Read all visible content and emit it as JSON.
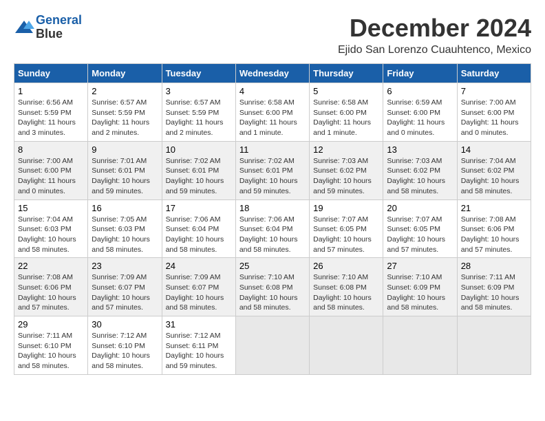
{
  "header": {
    "logo_line1": "General",
    "logo_line2": "Blue",
    "month_title": "December 2024",
    "location": "Ejido San Lorenzo Cuauhtenco, Mexico"
  },
  "days_of_week": [
    "Sunday",
    "Monday",
    "Tuesday",
    "Wednesday",
    "Thursday",
    "Friday",
    "Saturday"
  ],
  "weeks": [
    [
      {
        "day": "1",
        "sunrise": "6:56 AM",
        "sunset": "5:59 PM",
        "daylight": "11 hours and 3 minutes."
      },
      {
        "day": "2",
        "sunrise": "6:57 AM",
        "sunset": "5:59 PM",
        "daylight": "11 hours and 2 minutes."
      },
      {
        "day": "3",
        "sunrise": "6:57 AM",
        "sunset": "5:59 PM",
        "daylight": "11 hours and 2 minutes."
      },
      {
        "day": "4",
        "sunrise": "6:58 AM",
        "sunset": "6:00 PM",
        "daylight": "11 hours and 1 minute."
      },
      {
        "day": "5",
        "sunrise": "6:58 AM",
        "sunset": "6:00 PM",
        "daylight": "11 hours and 1 minute."
      },
      {
        "day": "6",
        "sunrise": "6:59 AM",
        "sunset": "6:00 PM",
        "daylight": "11 hours and 0 minutes."
      },
      {
        "day": "7",
        "sunrise": "7:00 AM",
        "sunset": "6:00 PM",
        "daylight": "11 hours and 0 minutes."
      }
    ],
    [
      {
        "day": "8",
        "sunrise": "7:00 AM",
        "sunset": "6:00 PM",
        "daylight": "11 hours and 0 minutes."
      },
      {
        "day": "9",
        "sunrise": "7:01 AM",
        "sunset": "6:01 PM",
        "daylight": "10 hours and 59 minutes."
      },
      {
        "day": "10",
        "sunrise": "7:02 AM",
        "sunset": "6:01 PM",
        "daylight": "10 hours and 59 minutes."
      },
      {
        "day": "11",
        "sunrise": "7:02 AM",
        "sunset": "6:01 PM",
        "daylight": "10 hours and 59 minutes."
      },
      {
        "day": "12",
        "sunrise": "7:03 AM",
        "sunset": "6:02 PM",
        "daylight": "10 hours and 59 minutes."
      },
      {
        "day": "13",
        "sunrise": "7:03 AM",
        "sunset": "6:02 PM",
        "daylight": "10 hours and 58 minutes."
      },
      {
        "day": "14",
        "sunrise": "7:04 AM",
        "sunset": "6:02 PM",
        "daylight": "10 hours and 58 minutes."
      }
    ],
    [
      {
        "day": "15",
        "sunrise": "7:04 AM",
        "sunset": "6:03 PM",
        "daylight": "10 hours and 58 minutes."
      },
      {
        "day": "16",
        "sunrise": "7:05 AM",
        "sunset": "6:03 PM",
        "daylight": "10 hours and 58 minutes."
      },
      {
        "day": "17",
        "sunrise": "7:06 AM",
        "sunset": "6:04 PM",
        "daylight": "10 hours and 58 minutes."
      },
      {
        "day": "18",
        "sunrise": "7:06 AM",
        "sunset": "6:04 PM",
        "daylight": "10 hours and 58 minutes."
      },
      {
        "day": "19",
        "sunrise": "7:07 AM",
        "sunset": "6:05 PM",
        "daylight": "10 hours and 57 minutes."
      },
      {
        "day": "20",
        "sunrise": "7:07 AM",
        "sunset": "6:05 PM",
        "daylight": "10 hours and 57 minutes."
      },
      {
        "day": "21",
        "sunrise": "7:08 AM",
        "sunset": "6:06 PM",
        "daylight": "10 hours and 57 minutes."
      }
    ],
    [
      {
        "day": "22",
        "sunrise": "7:08 AM",
        "sunset": "6:06 PM",
        "daylight": "10 hours and 57 minutes."
      },
      {
        "day": "23",
        "sunrise": "7:09 AM",
        "sunset": "6:07 PM",
        "daylight": "10 hours and 57 minutes."
      },
      {
        "day": "24",
        "sunrise": "7:09 AM",
        "sunset": "6:07 PM",
        "daylight": "10 hours and 58 minutes."
      },
      {
        "day": "25",
        "sunrise": "7:10 AM",
        "sunset": "6:08 PM",
        "daylight": "10 hours and 58 minutes."
      },
      {
        "day": "26",
        "sunrise": "7:10 AM",
        "sunset": "6:08 PM",
        "daylight": "10 hours and 58 minutes."
      },
      {
        "day": "27",
        "sunrise": "7:10 AM",
        "sunset": "6:09 PM",
        "daylight": "10 hours and 58 minutes."
      },
      {
        "day": "28",
        "sunrise": "7:11 AM",
        "sunset": "6:09 PM",
        "daylight": "10 hours and 58 minutes."
      }
    ],
    [
      {
        "day": "29",
        "sunrise": "7:11 AM",
        "sunset": "6:10 PM",
        "daylight": "10 hours and 58 minutes."
      },
      {
        "day": "30",
        "sunrise": "7:12 AM",
        "sunset": "6:10 PM",
        "daylight": "10 hours and 58 minutes."
      },
      {
        "day": "31",
        "sunrise": "7:12 AM",
        "sunset": "6:11 PM",
        "daylight": "10 hours and 59 minutes."
      },
      null,
      null,
      null,
      null
    ]
  ]
}
